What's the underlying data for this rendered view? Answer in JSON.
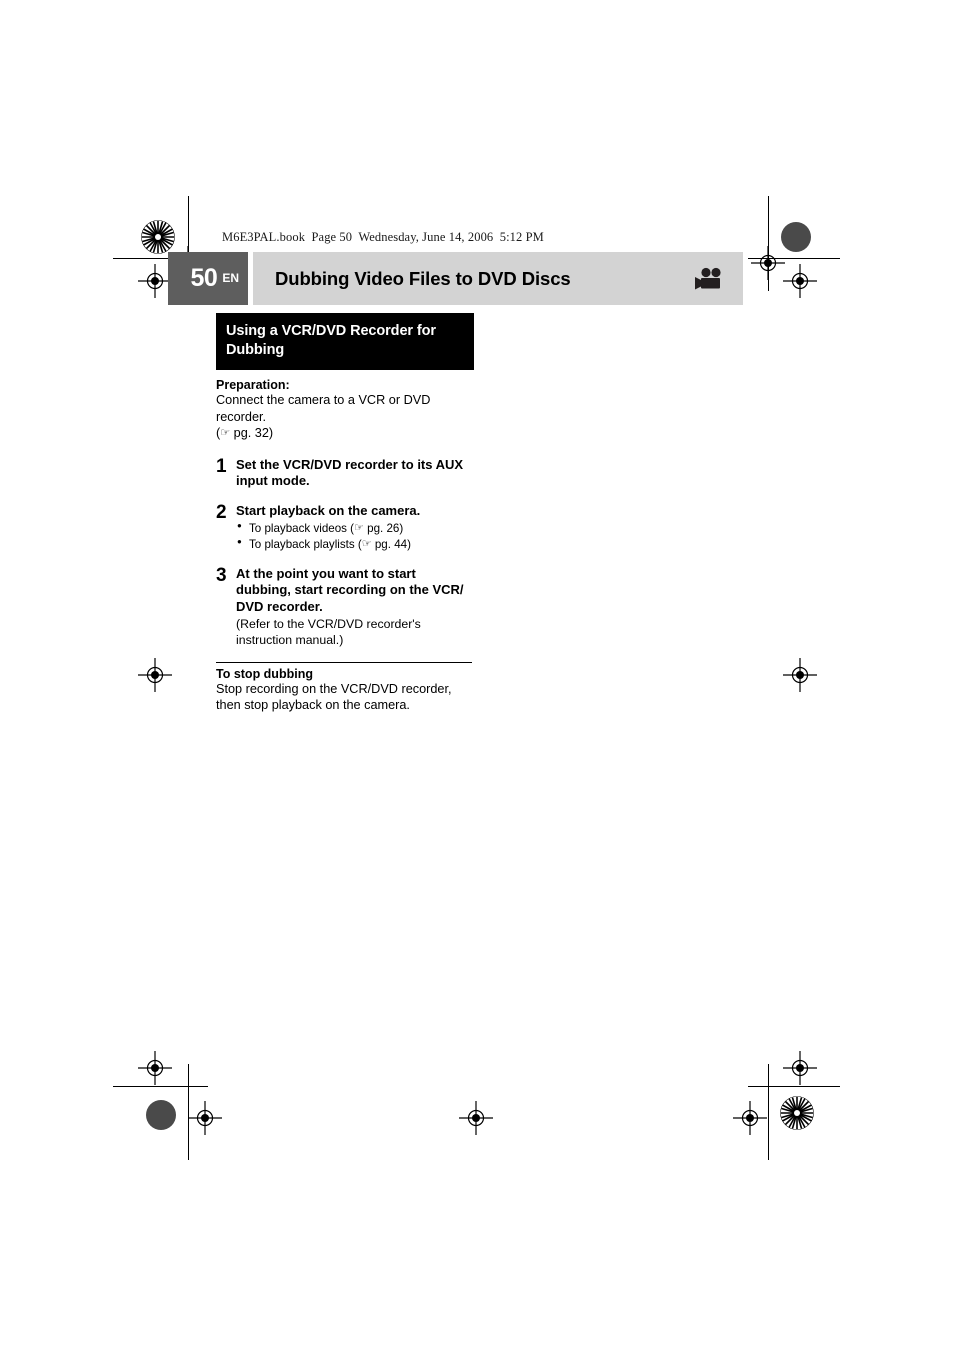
{
  "file_header": "M6E3PAL.book  Page 50  Wednesday, June 14, 2006  5:12 PM",
  "header": {
    "page_number": "50",
    "language_code": "EN",
    "chapter_title": "Dubbing Video Files to DVD Discs",
    "icon": "video-camera-icon",
    "pagenum_bg": "#5e5e5e",
    "title_bg": "#d3d3d3"
  },
  "section": {
    "title_line1": "Using a VCR/DVD Recorder for",
    "title_line2": "Dubbing",
    "title_bg": "#000000",
    "title_color": "#ffffff"
  },
  "preparation": {
    "label": "Preparation:",
    "line1": "Connect the camera to a VCR or DVD recorder.",
    "ref_open": "(",
    "ref_icon": "☞",
    "ref_text": " pg. 32)"
  },
  "steps": [
    {
      "number": "1",
      "title": "Set the VCR/DVD recorder to its AUX input mode.",
      "bullets": [],
      "note": ""
    },
    {
      "number": "2",
      "title": "Start playback on the camera.",
      "bullets": [
        {
          "text_before": "To playback videos (",
          "ref_icon": "☞",
          "text_after": " pg. 26)"
        },
        {
          "text_before": "To playback playlists (",
          "ref_icon": "☞",
          "text_after": " pg. 44)"
        }
      ],
      "note": ""
    },
    {
      "number": "3",
      "title": "At the point you want to start dubbing, start recording on the VCR/ DVD recorder.",
      "bullets": [],
      "note": "(Refer to the VCR/DVD recorder's instruction manual.)"
    }
  ],
  "stop_section": {
    "heading": "To stop dubbing",
    "text": "Stop recording on the VCR/DVD recorder, then stop playback on the camera."
  }
}
